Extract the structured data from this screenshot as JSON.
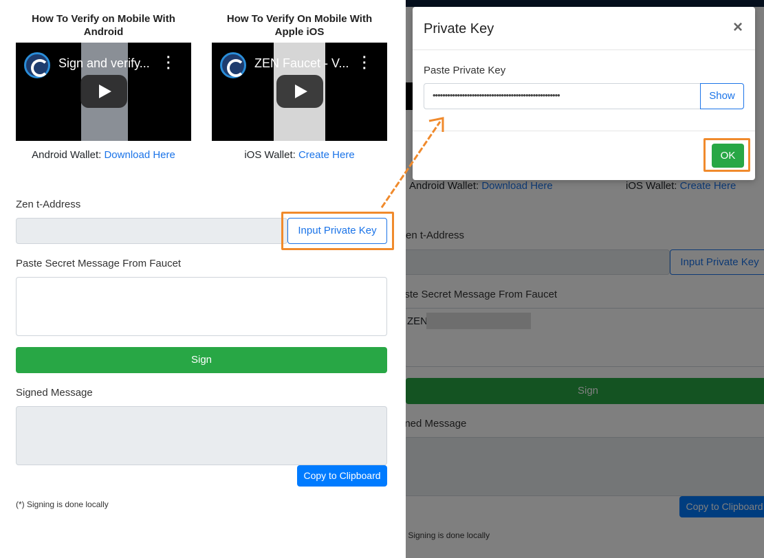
{
  "left": {
    "videos": [
      {
        "heading_line1": "How To Verify on Mobile With",
        "heading_line2": "Android",
        "video_title": "Sign and verify...",
        "wallet_label": "Android Wallet:",
        "wallet_link": "Download Here"
      },
      {
        "heading_line1": "How To Verify On Mobile With",
        "heading_line2": "Apple iOS",
        "video_title": "ZEN Faucet - V...",
        "wallet_label": "iOS Wallet:",
        "wallet_link": "Create Here"
      }
    ],
    "address_label": "Zen t-Address",
    "address_value": "",
    "input_key_button": "Input Private Key",
    "secret_label": "Paste Secret Message From Faucet",
    "secret_value": "",
    "sign_button": "Sign",
    "signed_label": "Signed Message",
    "copy_button": "Copy to Clipboard",
    "footnote": "(*) Signing is done locally"
  },
  "right": {
    "android_wallet_label": "Android Wallet:",
    "android_wallet_link": "Download Here",
    "ios_wallet_label": "iOS Wallet:",
    "ios_wallet_link": "Create Here",
    "address_label": "en t-Address",
    "input_key_button": "Input Private Key",
    "secret_label": "aste Secret Message From Faucet",
    "secret_value_prefix": "ZEN",
    "sign_button": "Sign",
    "signed_label": "gned Message",
    "copy_button": "Copy to Clipboard",
    "footnote": ") Signing is done locally"
  },
  "modal": {
    "title": "Private Key",
    "close": "×",
    "field_label": "Paste Private Key",
    "field_value": "••••••••••••••••••••••••••••••••••••••••••••••••••••",
    "show_button": "Show",
    "ok_button": "OK"
  },
  "colors": {
    "highlight": "#f08a2c",
    "link": "#1a73e8",
    "green": "#28a745",
    "blue": "#007bff"
  }
}
